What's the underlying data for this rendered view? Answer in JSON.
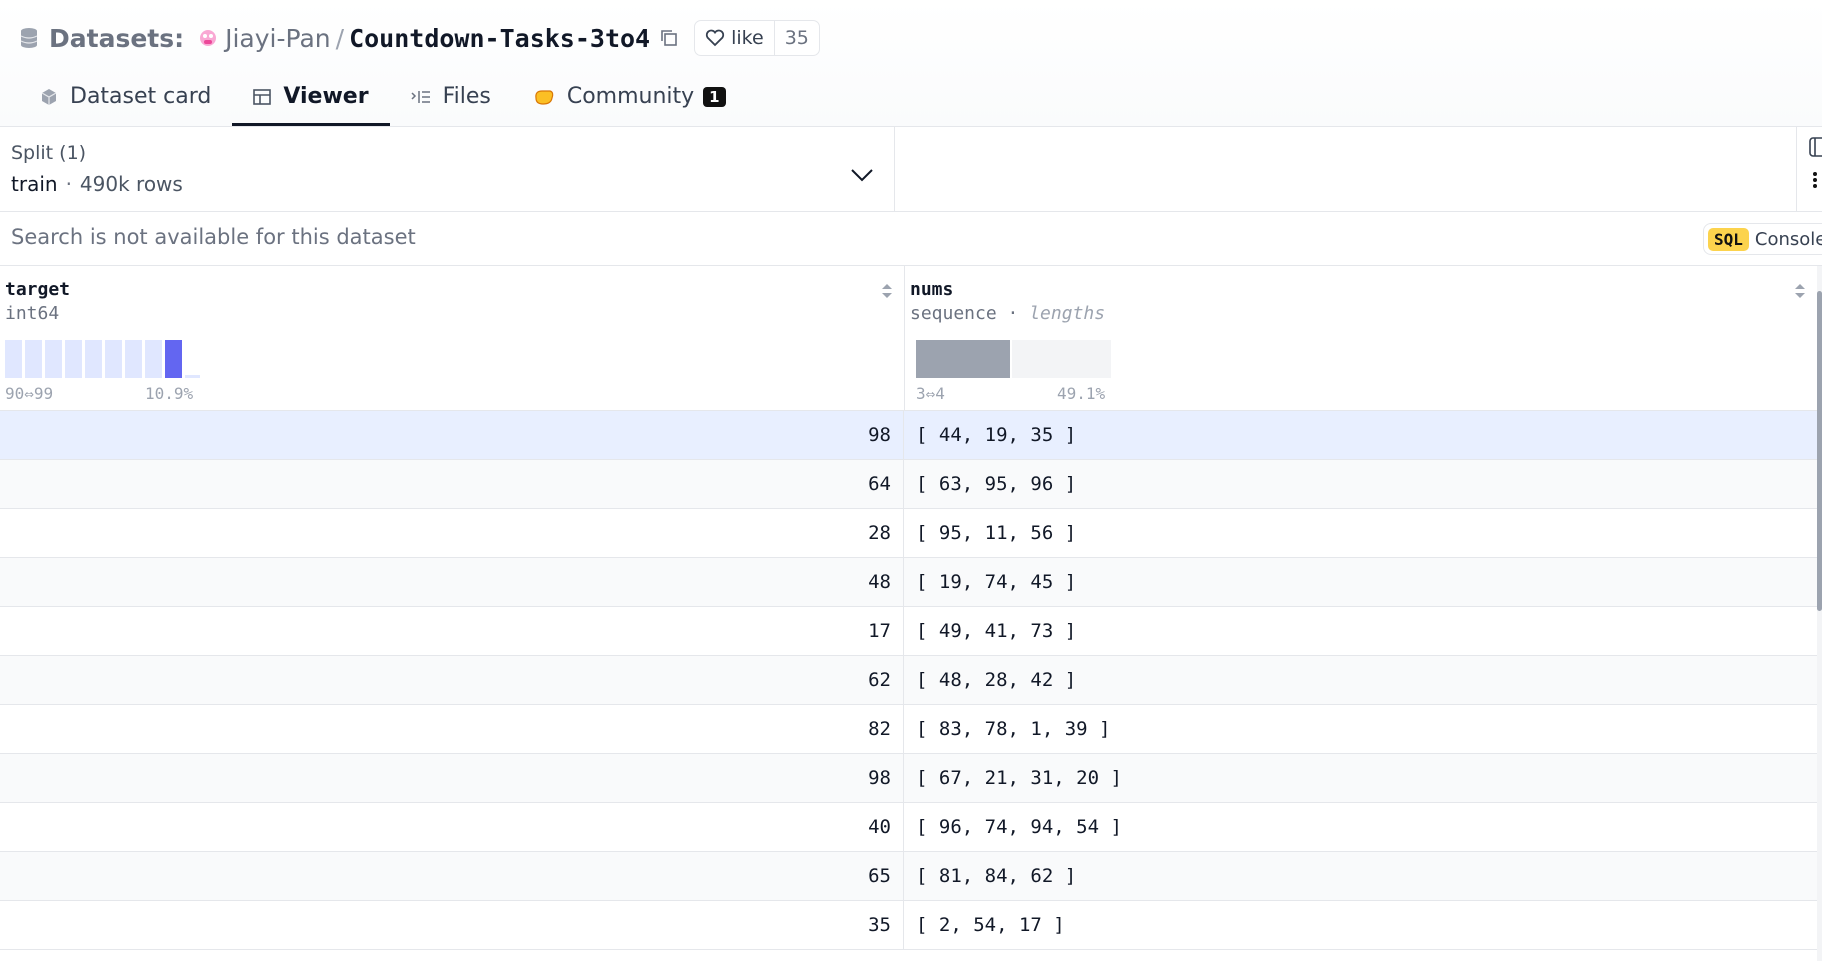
{
  "header": {
    "datasets_label": "Datasets:",
    "owner": "Jiayi-Pan",
    "separator": "/",
    "repo_name": "Countdown-Tasks-3to4",
    "like_label": "like",
    "like_count": "35"
  },
  "tabs": [
    {
      "label": "Dataset card",
      "icon": "cube-icon"
    },
    {
      "label": "Viewer",
      "icon": "table-icon",
      "active": true
    },
    {
      "label": "Files",
      "icon": "files-icon"
    },
    {
      "label": "Community",
      "icon": "community-icon",
      "badge": "1"
    }
  ],
  "split": {
    "label": "Split (1)",
    "value": "train",
    "dot": "·",
    "rows": "490k rows"
  },
  "search": {
    "placeholder": "Search is not available for this dataset",
    "sql_badge": "SQL",
    "console_label": "Console"
  },
  "columns": [
    {
      "name": "target",
      "type": "int64",
      "hist_range": "90⇔99",
      "hist_pct": "10.9%",
      "hist_highlight_index": 8,
      "hist_color": "#e0e7ff",
      "hist_highlight_color": "#6366f1"
    },
    {
      "name": "nums",
      "type": "sequence",
      "type_extra": "lengths",
      "seg_range": "3⇔4",
      "seg_pct": "49.1%",
      "seg_fraction": 0.491
    }
  ],
  "rows": [
    {
      "target": "98",
      "nums": "[ 44, 19, 35 ]"
    },
    {
      "target": "64",
      "nums": "[ 63, 95, 96 ]"
    },
    {
      "target": "28",
      "nums": "[ 95, 11, 56 ]"
    },
    {
      "target": "48",
      "nums": "[ 19, 74, 45 ]"
    },
    {
      "target": "17",
      "nums": "[ 49, 41, 73 ]"
    },
    {
      "target": "62",
      "nums": "[ 48, 28, 42 ]"
    },
    {
      "target": "82",
      "nums": "[ 83, 78, 1, 39 ]"
    },
    {
      "target": "98",
      "nums": "[ 67, 21, 31, 20 ]"
    },
    {
      "target": "40",
      "nums": "[ 96, 74, 94, 54 ]"
    },
    {
      "target": "65",
      "nums": "[ 81, 84, 62 ]"
    },
    {
      "target": "35",
      "nums": "[ 2, 54, 17 ]"
    }
  ]
}
